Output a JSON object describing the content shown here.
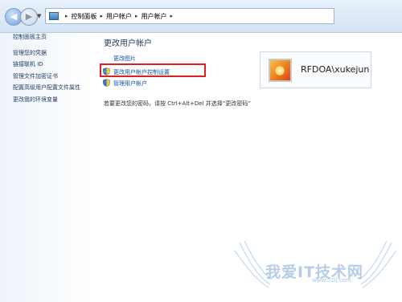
{
  "address_bar": {
    "segments": [
      "控制面板",
      "用户帐户",
      "用户帐户"
    ]
  },
  "sidebar": {
    "items": [
      {
        "label": "控制面板主页"
      },
      {
        "label": "管理您的凭据"
      },
      {
        "label": "链接联机 ID"
      },
      {
        "label": "管理文件加密证书"
      },
      {
        "label": "配置高级用户配置文件属性"
      },
      {
        "label": "更改我的环境变量"
      }
    ]
  },
  "main": {
    "title": "更改用户帐户",
    "links": [
      {
        "label": "更改图片"
      },
      {
        "label": "更改用户帐户控制设置"
      },
      {
        "label": "管理用户帐户"
      }
    ],
    "note": "若要更改您的密码，请按 Ctrl+Alt+Del 并选择“更改密码”"
  },
  "user": {
    "name": "RFDOA\\xukejun"
  },
  "watermark": {
    "text": "我爱IT技术网",
    "url": "www.52ij.com"
  },
  "colors": {
    "link": "#0f52a8",
    "highlight": "#e02020"
  },
  "icons": {
    "back": "back-arrow-icon",
    "forward": "forward-arrow-icon",
    "shield": "uac-shield-icon"
  }
}
